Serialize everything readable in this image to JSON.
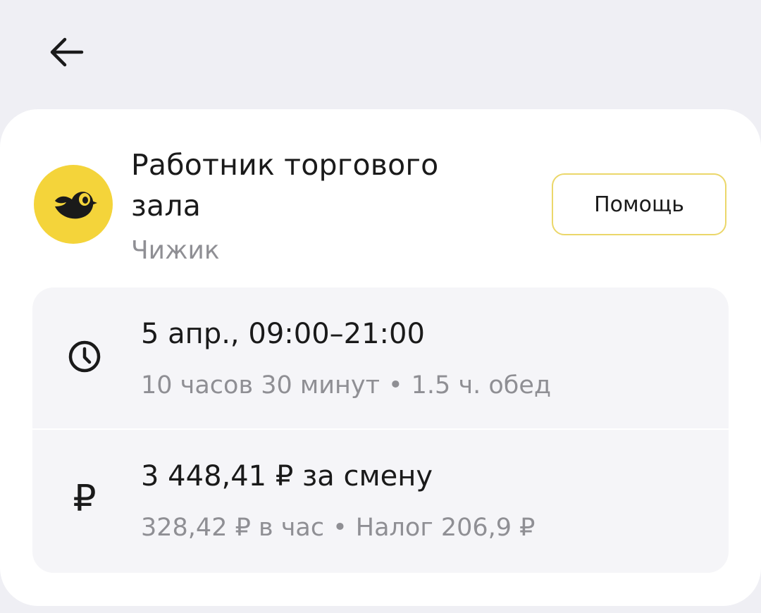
{
  "header": {
    "back_icon": "arrow-left-icon"
  },
  "vacancy": {
    "title": "Работник торгового зала",
    "employer": "Чижик",
    "employer_logo": "bird-logo",
    "help_label": "Помощь"
  },
  "shift": {
    "icon": "clock-icon",
    "datetime": "5 апр., 09:00–21:00",
    "duration": "10 часов 30 минут",
    "separator": "•",
    "lunch": "1.5 ч. обед"
  },
  "payment": {
    "icon": "ruble-icon",
    "icon_glyph": "₽",
    "total": "3 448,41 ₽ за смену",
    "hourly": "328,42 ₽ в час",
    "separator": "•",
    "tax": "Налог 206,9 ₽"
  },
  "colors": {
    "background": "#efeff4",
    "card": "#ffffff",
    "accent_yellow": "#f4d43a",
    "help_border": "#ebd76a",
    "text_primary": "#1a1a1a",
    "text_secondary": "#8f8f94"
  }
}
